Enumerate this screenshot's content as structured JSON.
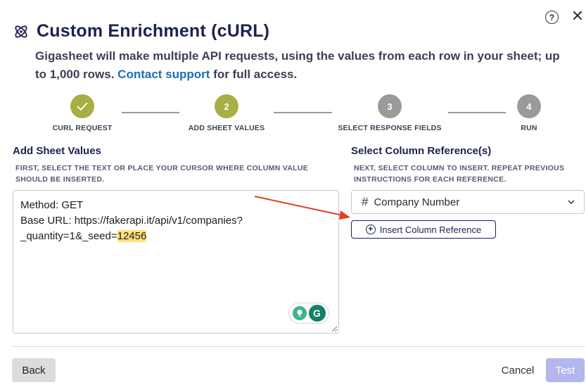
{
  "dialog": {
    "title": "Custom Enrichment (cURL)",
    "subtitle_before_link": "Gigasheet will make multiple API requests, using the values from each row in your sheet; up to 1,000 rows. ",
    "subtitle_link": "Contact support",
    "subtitle_after_link": " for full access.",
    "help_label": "?",
    "close_label": "✕"
  },
  "stepper": {
    "steps": [
      {
        "number": "✓",
        "label": "CURL REQUEST",
        "state": "done"
      },
      {
        "number": "2",
        "label": "ADD SHEET VALUES",
        "state": "active"
      },
      {
        "number": "3",
        "label": "SELECT RESPONSE FIELDS",
        "state": "todo"
      },
      {
        "number": "4",
        "label": "RUN",
        "state": "todo"
      }
    ]
  },
  "left_panel": {
    "title": "Add Sheet Values",
    "hint": "FIRST, SELECT THE TEXT OR PLACE YOUR CURSOR WHERE COLUMN VALUE SHOULD BE INSERTED.",
    "line1": "Method: GET",
    "line2_prefix": "Base URL: https://fakerapi.it/api/v1/companies?",
    "line3_prefix": "_quantity=1&_seed=",
    "highlighted": "12456"
  },
  "right_panel": {
    "title": "Select Column Reference(s)",
    "hint": "NEXT, SELECT COLUMN TO INSERT. REPEAT PREVIOUS INSTRUCTIONS FOR EACH REFERENCE.",
    "selected_column": "Company Number",
    "insert_button": "Insert Column Reference"
  },
  "footer": {
    "back": "Back",
    "cancel": "Cancel",
    "test": "Test"
  },
  "colors": {
    "brand": "#1c2250",
    "link": "#1a6fb5",
    "step_active": "#a8ad44",
    "step_todo": "#9a9a9a",
    "highlight": "#fde27a",
    "test_disabled": "#b4b6ee",
    "annotation_arrow": "#e0402a"
  },
  "icons": [
    "help-icon",
    "close-icon",
    "atom-icon",
    "check-icon",
    "hash-icon",
    "chevron-down-icon",
    "plus-circle-icon",
    "grammarly-bulb-icon",
    "grammarly-logo-icon"
  ]
}
